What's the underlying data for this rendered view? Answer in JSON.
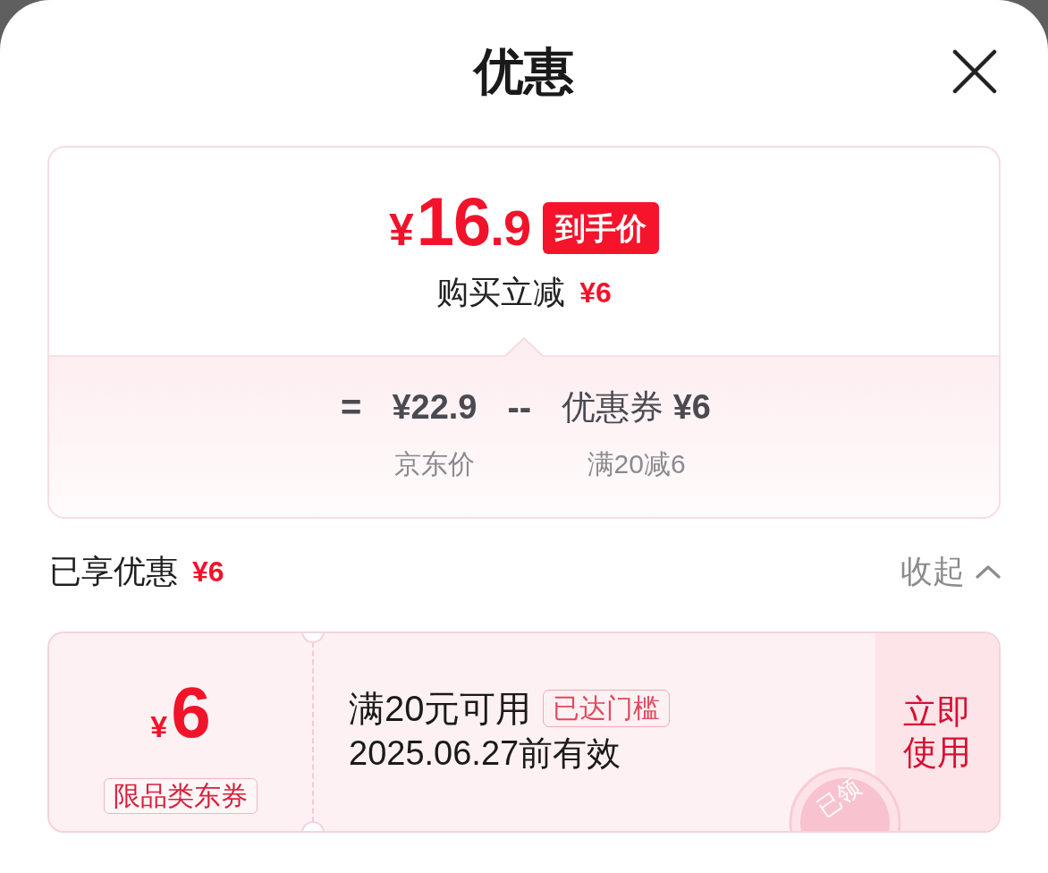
{
  "sheet": {
    "title": "优惠"
  },
  "price_summary": {
    "final_price": {
      "currency": "¥",
      "integer": "16",
      "fraction": ".9"
    },
    "badge": "到手价",
    "instant_discount": {
      "label": "购买立减",
      "amount": "¥6"
    },
    "breakdown": [
      {
        "kind": "operator",
        "text": "="
      },
      {
        "kind": "price",
        "value": "¥22.9",
        "caption": "京东价"
      },
      {
        "kind": "operator",
        "text": "--"
      },
      {
        "kind": "coupon",
        "value": "优惠券 **¥6**",
        "caption": "满20减6"
      }
    ]
  },
  "applied": {
    "label": "已享优惠",
    "amount": "¥6",
    "toggle": {
      "label": "收起",
      "expanded": true
    }
  },
  "coupons": [
    {
      "currency": "¥",
      "amount": "6",
      "category_tag": "限品类东券",
      "condition": "满20元可用",
      "status_tag": "已达门槛",
      "validity": "2025.06.27前有效",
      "action": "立即使用",
      "stamp": "已领"
    }
  ]
}
